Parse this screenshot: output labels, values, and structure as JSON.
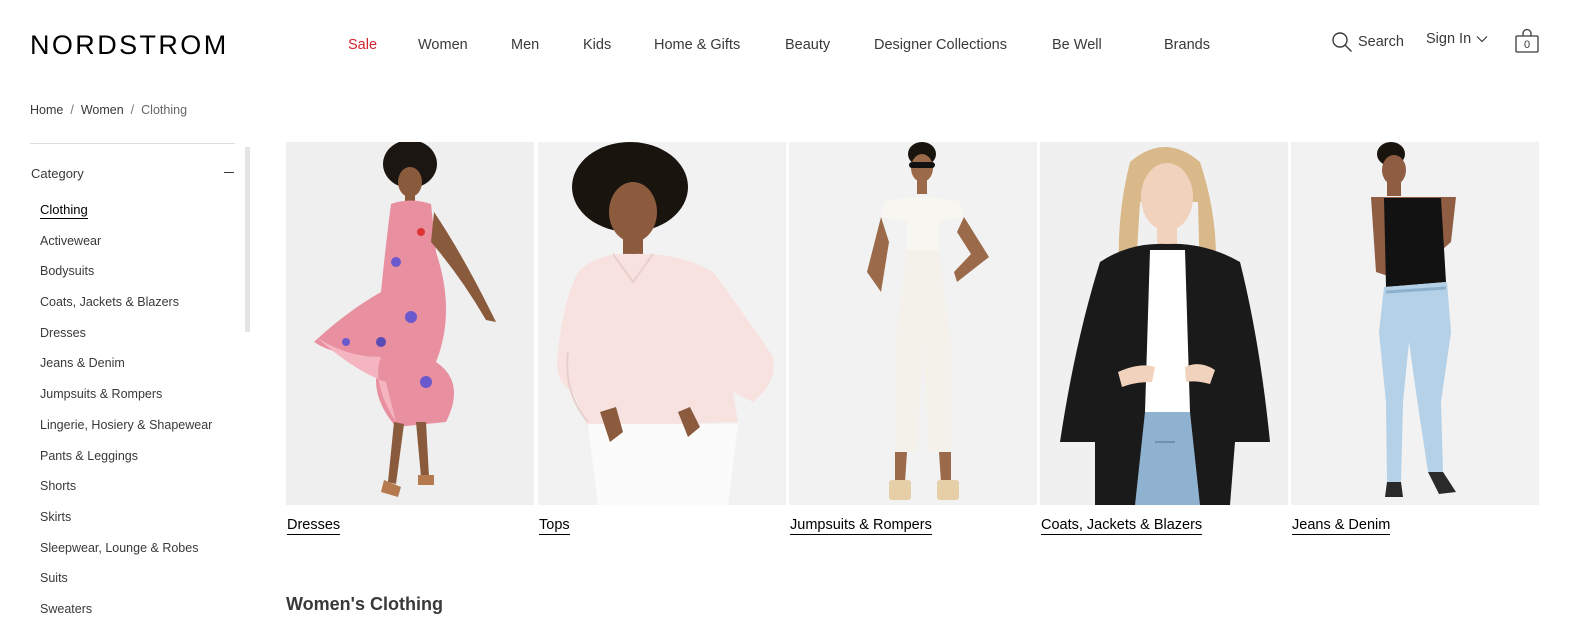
{
  "header": {
    "logo": "NORDSTROM",
    "nav": [
      "Sale",
      "Women",
      "Men",
      "Kids",
      "Home & Gifts",
      "Beauty",
      "Designer Collections",
      "Be Well",
      "Brands"
    ],
    "search_label": "Search",
    "signin_label": "Sign In",
    "bag_count": "0",
    "sale_color": "#d5232e"
  },
  "breadcrumb": [
    "Home",
    "Women",
    "Clothing"
  ],
  "sidebar": {
    "heading": "Category",
    "items": [
      "Clothing",
      "Activewear",
      "Bodysuits",
      "Coats, Jackets & Blazers",
      "Dresses",
      "Jeans & Denim",
      "Jumpsuits & Rompers",
      "Lingerie, Hosiery & Shapewear",
      "Pants & Leggings",
      "Shorts",
      "Skirts",
      "Sleepwear, Lounge & Robes",
      "Suits",
      "Sweaters"
    ]
  },
  "tiles": [
    {
      "label": "Dresses"
    },
    {
      "label": "Tops"
    },
    {
      "label": "Jumpsuits & Rompers"
    },
    {
      "label": "Coats, Jackets & Blazers"
    },
    {
      "label": "Jeans & Denim"
    }
  ],
  "section_title": "Women's Clothing"
}
